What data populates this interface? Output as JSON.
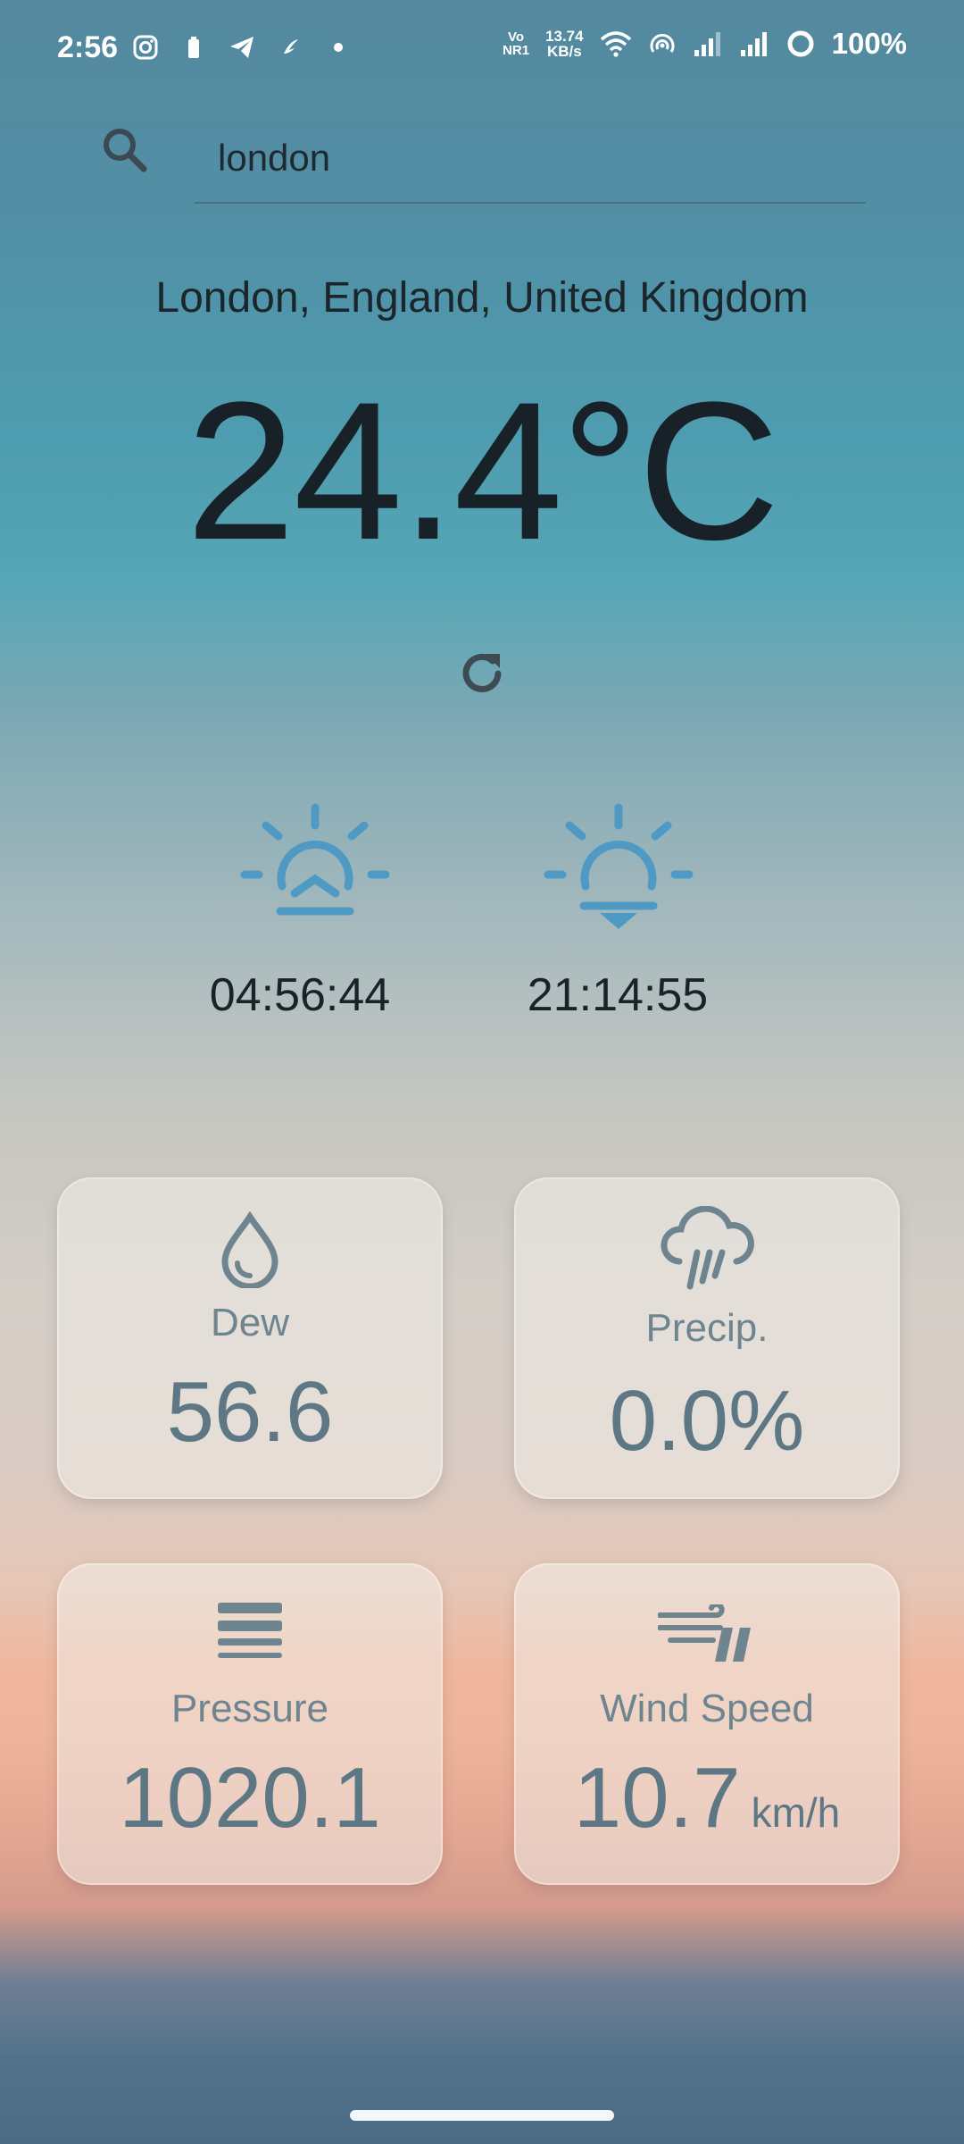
{
  "status_bar": {
    "time": "2:56",
    "network_top": "Vo",
    "network_bottom": "NR1",
    "speed_value": "13.74",
    "speed_unit": "KB/s",
    "battery": "100%"
  },
  "search": {
    "value": "london"
  },
  "location": "London, England, United Kingdom",
  "temperature": "24.4°C",
  "sun": {
    "sunrise_time": "04:56:44",
    "sunset_time": "21:14:55"
  },
  "cards": {
    "dew": {
      "label": "Dew",
      "value": "56.6"
    },
    "precip": {
      "label": "Precip.",
      "value": "0.0%"
    },
    "pressure": {
      "label": "Pressure",
      "value": "1020.1"
    },
    "wind": {
      "label": "Wind Speed",
      "value": "10.7",
      "unit": "km/h"
    }
  },
  "icons": {
    "search": "search-icon",
    "refresh": "refresh-icon",
    "sunrise": "sunrise-icon",
    "sunset": "sunset-icon",
    "dew": "water-drop-icon",
    "precip": "rain-cloud-icon",
    "pressure": "pressure-lines-icon",
    "wind": "wind-icon"
  },
  "colors": {
    "sun_icon": "#4f9ac4",
    "card_text": "#5d7785"
  }
}
